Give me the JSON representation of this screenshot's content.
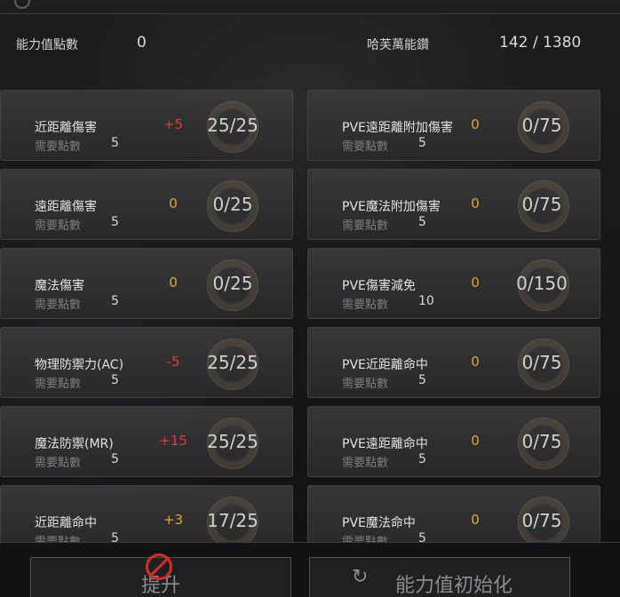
{
  "header": {
    "points_label": "能力值點數",
    "points_value": "0",
    "crystal_label": "哈芙萬能鑽",
    "crystal_value": "142 / 1380"
  },
  "stats_left": [
    {
      "name": "近距離傷害",
      "req_label": "需要點數",
      "cost": "5",
      "delta": "+5",
      "delta_color": "#e03a3a",
      "level": "25/25"
    },
    {
      "name": "遠距離傷害",
      "req_label": "需要點數",
      "cost": "5",
      "delta": "0",
      "delta_color": "#e0a534",
      "level": "0/25"
    },
    {
      "name": "魔法傷害",
      "req_label": "需要點數",
      "cost": "5",
      "delta": "0",
      "delta_color": "#e0a534",
      "level": "0/25"
    },
    {
      "name": "物理防禦力(AC)",
      "req_label": "需要點數",
      "cost": "5",
      "delta": "-5",
      "delta_color": "#e03a3a",
      "level": "25/25"
    },
    {
      "name": "魔法防禦(MR)",
      "req_label": "需要點數",
      "cost": "5",
      "delta": "+15",
      "delta_color": "#e03a3a",
      "level": "25/25"
    },
    {
      "name": "近距離命中",
      "req_label": "需要點數",
      "cost": "5",
      "delta": "+3",
      "delta_color": "#e0a534",
      "level": "17/25"
    }
  ],
  "stats_right": [
    {
      "name": "PVE遠距離附加傷害",
      "req_label": "需要點數",
      "cost": "5",
      "delta": "0",
      "delta_color": "#e0a534",
      "level": "0/75"
    },
    {
      "name": "PVE魔法附加傷害",
      "req_label": "需要點數",
      "cost": "5",
      "delta": "0",
      "delta_color": "#e0a534",
      "level": "0/75"
    },
    {
      "name": "PVE傷害減免",
      "req_label": "需要點數",
      "cost": "10",
      "delta": "0",
      "delta_color": "#e0a534",
      "level": "0/150"
    },
    {
      "name": "PVE近距離命中",
      "req_label": "需要點數",
      "cost": "5",
      "delta": "0",
      "delta_color": "#e0a534",
      "level": "0/75"
    },
    {
      "name": "PVE遠距離命中",
      "req_label": "需要點數",
      "cost": "5",
      "delta": "0",
      "delta_color": "#e0a534",
      "level": "0/75"
    },
    {
      "name": "PVE魔法命中",
      "req_label": "需要點數",
      "cost": "5",
      "delta": "0",
      "delta_color": "#e0a534",
      "level": "0/75"
    }
  ],
  "buttons": {
    "confirm_label": "提升",
    "reset_label": "能力值初始化"
  },
  "icons": {
    "blocked": "no-entry-icon",
    "reset": "refresh-icon"
  }
}
